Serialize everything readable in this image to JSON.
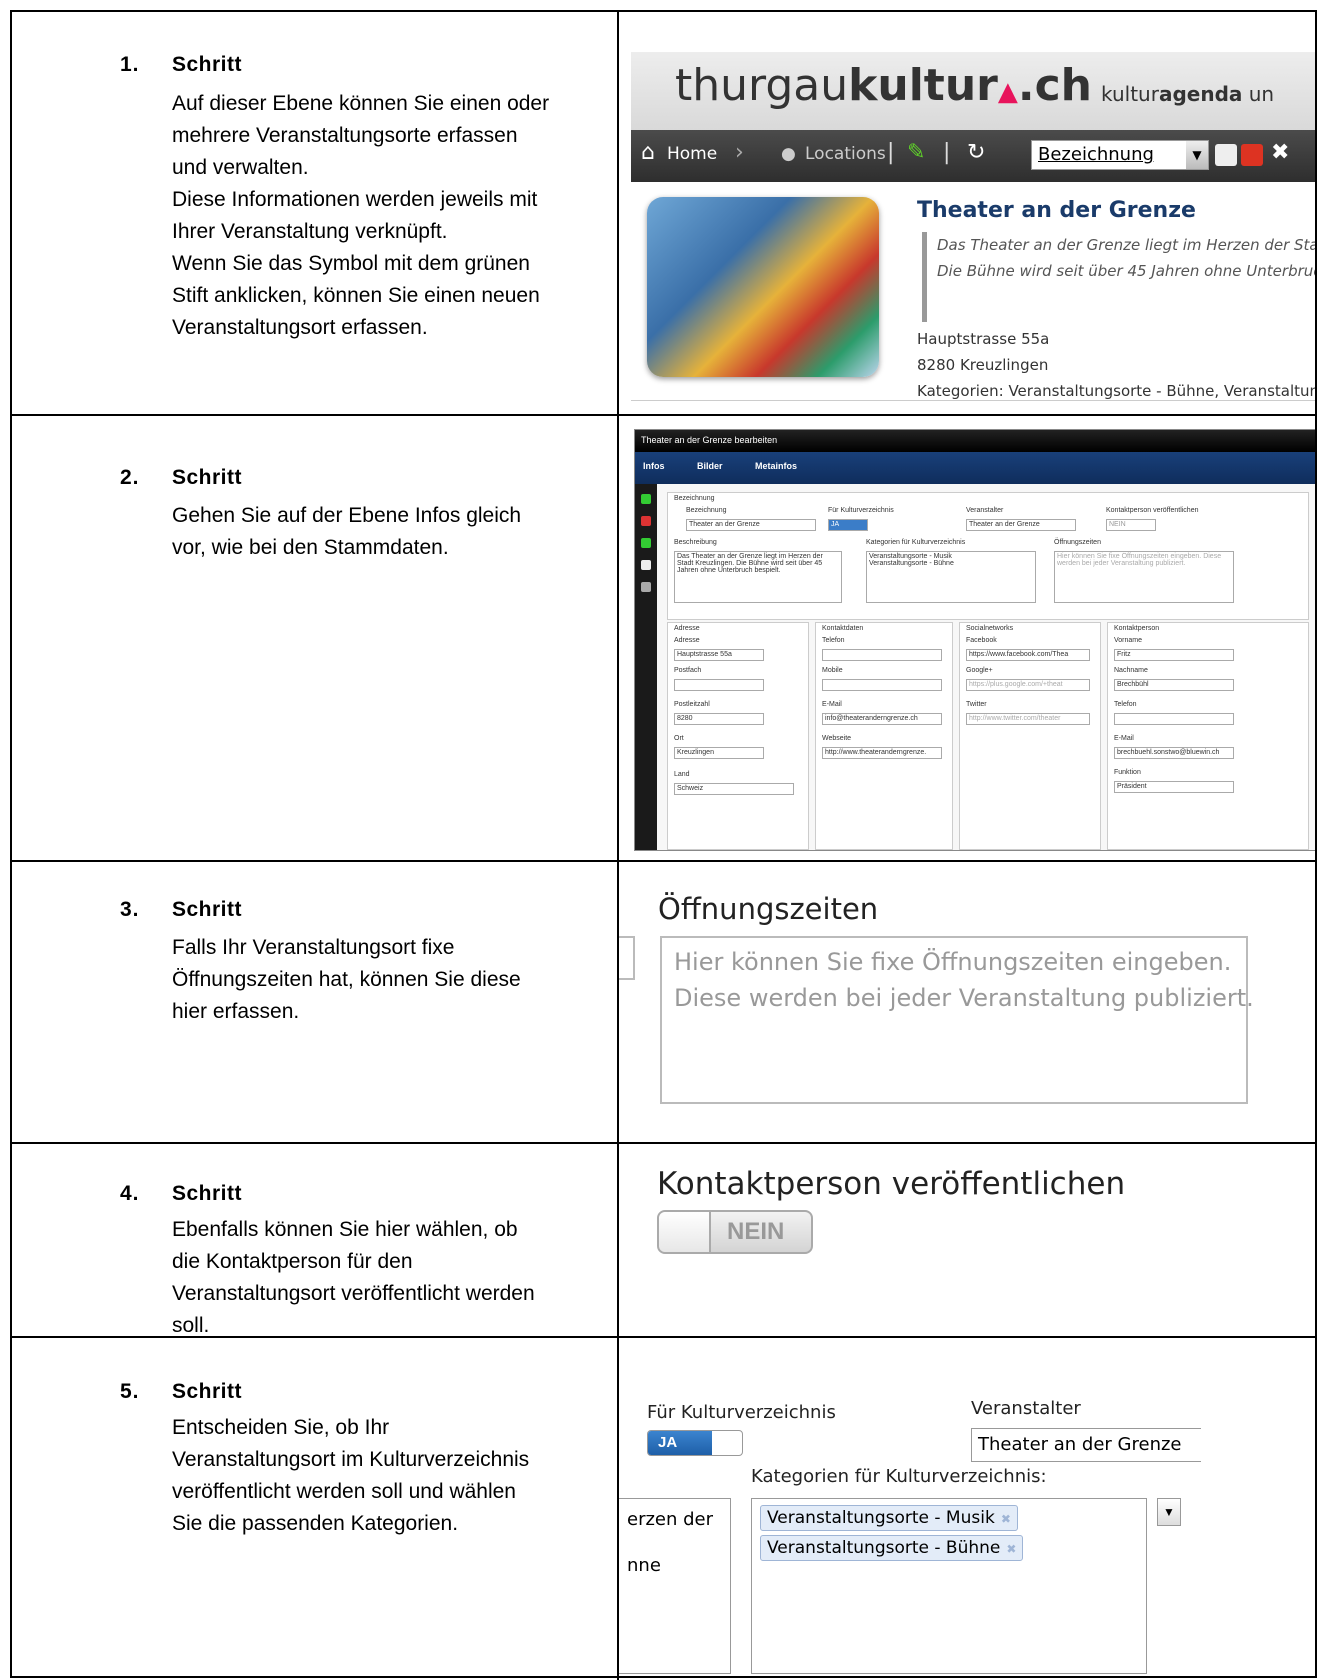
{
  "steps": [
    {
      "num": "1.",
      "title": "Schritt",
      "text": "Auf dieser Ebene können Sie einen oder\nmehrere Veranstaltungsorte erfassen\nund verwalten.\nDiese Informationen werden jeweils mit\nIhrer Veranstaltung verknüpft.\nWenn Sie das Symbol mit dem grünen\nStift anklicken, können Sie einen neuen\nVeranstaltungsort erfassen."
    },
    {
      "num": "2.",
      "title": "Schritt",
      "text": "Gehen Sie auf der Ebene Infos gleich\nvor, wie bei den Stammdaten."
    },
    {
      "num": "3.",
      "title": "Schritt",
      "text": "Falls Ihr Veranstaltungsort fixe\nÖffnungszeiten hat, können Sie diese\nhier erfassen."
    },
    {
      "num": "4.",
      "title": "Schritt",
      "text": "Ebenfalls können Sie hier wählen, ob\ndie Kontaktperson für den\nVeranstaltungsort veröffentlicht werden\nsoll."
    },
    {
      "num": "5.",
      "title": "Schritt",
      "text": "Entscheiden Sie, ob Ihr\nVeranstaltungsort im Kulturverzeichnis\nveröffentlicht werden soll und wählen\nSie die passenden Kategorien."
    }
  ],
  "shot1": {
    "logo_a": "thurgau",
    "logo_b": "kultur",
    "logo_c": ".ch",
    "agenda_a": "kultur",
    "agenda_b": "agenda",
    "agenda_c": " un",
    "nav_home": "Home",
    "nav_locations": "Locations",
    "select_value": "Bezeichnung",
    "venue_title": "Theater an der Grenze",
    "venue_desc": "Das Theater an der Grenze liegt im Herzen der Stadt\nDie Bühne wird seit über 45 Jahren ohne Unterbruch",
    "venue_addr": "Hauptstrasse 55a\n8280 Kreuzlingen\nKategorien: Veranstaltungsorte - Bühne, Veranstaltungs"
  },
  "shot2": {
    "window_title": "Theater an der Grenze bearbeiten",
    "tab_infos": "Infos",
    "tab_bilder": "Bilder",
    "tab_meta": "Metainfos",
    "section_bezeichnung": "Bezeichnung",
    "lbl_bezeichnung": "Bezeichnung",
    "val_bezeichnung": "Theater an der Grenze",
    "lbl_kulturverzeichnis": "Für Kulturverzeichnis",
    "val_kulturverzeichnis": "JA",
    "lbl_veranstalter": "Veranstalter",
    "val_veranstalter": "Theater an der Grenze",
    "lbl_kontakt_pub": "Kontaktperson veröffentlichen",
    "val_kontakt_pub": "NEIN",
    "lbl_beschreibung": "Beschreibung",
    "val_beschreibung": "Das Theater an der Grenze liegt im Herzen der Stadt Kreuzlingen. Die Bühne wird seit über 45 Jahren ohne Unterbruch bespielt.",
    "lbl_kategorien": "Kategorien für Kulturverzeichnis",
    "val_kat1": "Veranstaltungsorte - Musik",
    "val_kat2": "Veranstaltungsorte - Bühne",
    "lbl_oeffnung": "Öffnungszeiten",
    "val_oeffnung": "Hier können Sie fixe Öffnungszeiten eingeben. Diese werden bei jeder Veranstaltung publiziert.",
    "sec_adresse": "Adresse",
    "sec_kontaktdaten": "Kontaktdaten",
    "sec_social": "Socialnetworks",
    "sec_kontaktperson": "Kontaktperson",
    "lbl_adresse": "Adresse",
    "val_adresse": "Hauptstrasse 55a",
    "lbl_postfach": "Postfach",
    "lbl_plz": "Postleitzahl",
    "val_plz": "8280",
    "lbl_ort": "Ort",
    "val_ort": "Kreuzlingen",
    "lbl_land": "Land",
    "val_land": "Schweiz",
    "lbl_telefon": "Telefon",
    "lbl_mobile": "Mobile",
    "lbl_email": "E-Mail",
    "val_email": "info@theateranderngrenze.ch",
    "lbl_webseite": "Webseite",
    "val_webseite": "http://www.theateranderngrenze.",
    "lbl_facebook": "Facebook",
    "val_facebook": "https://www.facebook.com/Thea",
    "lbl_google": "Google+",
    "val_google": "https://plus.google.com/+theat",
    "lbl_twitter": "Twitter",
    "val_twitter": "http://www.twitter.com/theater",
    "lbl_vorname": "Vorname",
    "val_vorname": "Fritz",
    "lbl_nachname": "Nachname",
    "val_nachname": "Brechbühl",
    "lbl_telefon2": "Telefon",
    "lbl_email2": "E-Mail",
    "val_email2": "brechbuehl.sonstwo@bluewin.ch",
    "lbl_funktion": "Funktion",
    "val_funktion": "Präsident"
  },
  "shot3": {
    "title": "Öffnungszeiten",
    "placeholder": "Hier können Sie fixe Öffnungszeiten eingeben.\nDiese werden bei jeder Veranstaltung publiziert."
  },
  "shot4": {
    "title": "Kontaktperson veröffentlichen",
    "toggle_label": "NEIN"
  },
  "shot5": {
    "lbl_kulturverzeichnis": "Für Kulturverzeichnis",
    "toggle_value": "JA",
    "lbl_veranstalter": "Veranstalter",
    "val_veranstalter": "Theater an der Grenze",
    "lbl_kategorien": "Kategorien für Kulturverzeichnis:",
    "desc_line1": "erzen der",
    "desc_line2": "nne",
    "tag1": "Veranstaltungsorte - Musik",
    "tag2": "Veranstaltungsorte - Bühne"
  }
}
